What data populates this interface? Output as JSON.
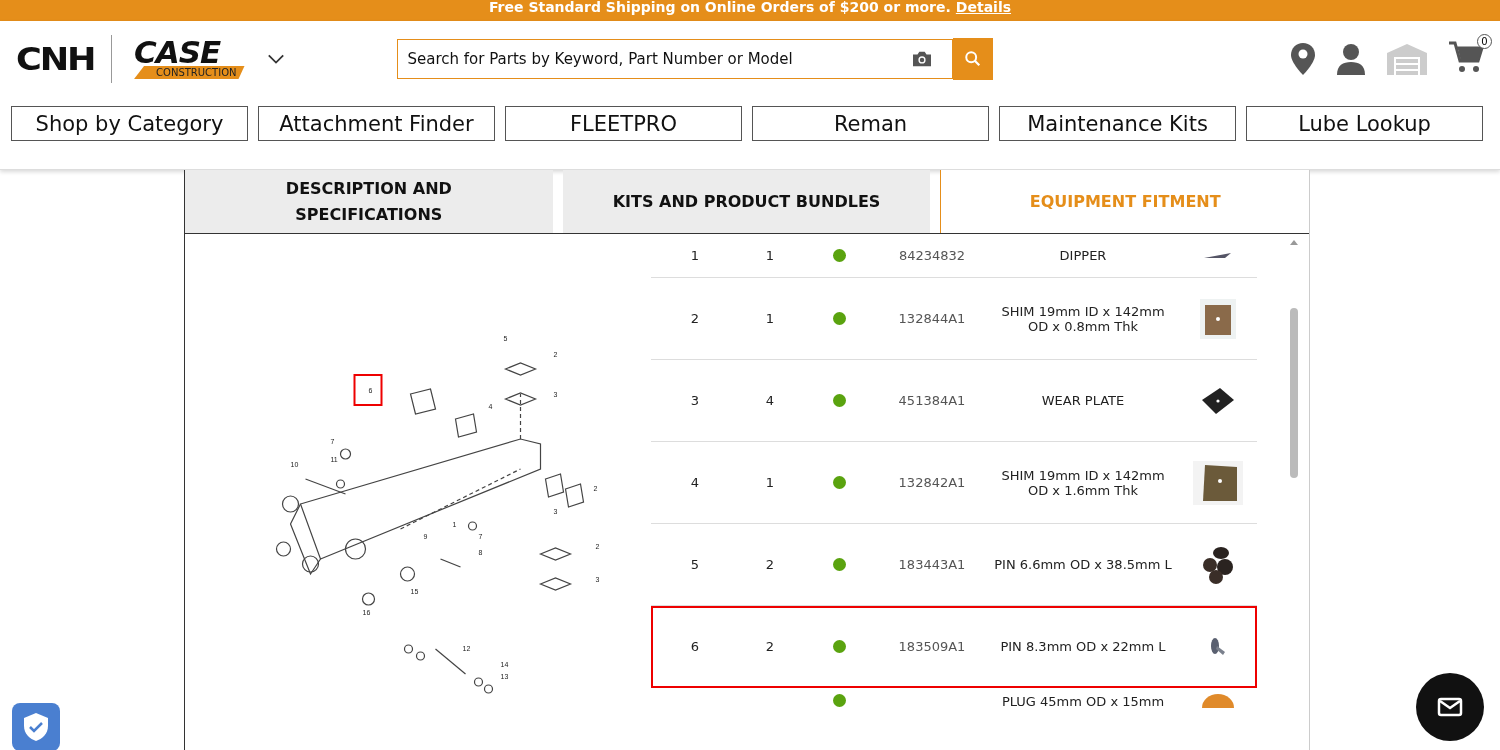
{
  "promo_banner": {
    "text": "Free Standard Shipping on Online Orders of $200 or more.",
    "link": "Details"
  },
  "header": {
    "logo": "CNH",
    "brand_small": "CASE",
    "brand_sub": "CONSTRUCTION",
    "search": {
      "placeholder": "Search for Parts by Keyword, Part Number or Model"
    },
    "cart_count": "0"
  },
  "nav": [
    "Shop by Category",
    "Attachment Finder",
    "FLEETPRO",
    "Reman",
    "Maintenance Kits",
    "Lube Lookup"
  ],
  "tabs": [
    {
      "label": "DESCRIPTION AND SPECIFICATIONS",
      "selected": false
    },
    {
      "label": "KITS AND PRODUCT BUNDLES",
      "selected": false
    },
    {
      "label": "EQUIPMENT FITMENT",
      "selected": true
    }
  ],
  "diagram": {
    "callouts": [
      {
        "label": "5",
        "highlighted": false
      },
      {
        "label": "2",
        "highlighted": false
      },
      {
        "label": "6",
        "highlighted": true
      },
      {
        "label": "4",
        "highlighted": false
      },
      {
        "label": "3",
        "highlighted": false
      },
      {
        "label": "7",
        "highlighted": false
      },
      {
        "label": "11",
        "highlighted": false
      },
      {
        "label": "10",
        "highlighted": false
      },
      {
        "label": "1",
        "highlighted": false
      },
      {
        "label": "9",
        "highlighted": false
      },
      {
        "label": "8",
        "highlighted": false
      },
      {
        "label": "7",
        "highlighted": false
      },
      {
        "label": "15",
        "highlighted": false
      },
      {
        "label": "16",
        "highlighted": false
      },
      {
        "label": "2",
        "highlighted": false
      },
      {
        "label": "3",
        "highlighted": false
      },
      {
        "label": "2",
        "highlighted": false
      },
      {
        "label": "3",
        "highlighted": false
      },
      {
        "label": "12",
        "highlighted": false
      },
      {
        "label": "14",
        "highlighted": false
      },
      {
        "label": "13",
        "highlighted": false
      }
    ]
  },
  "parts": [
    {
      "ref": "1",
      "qty": "1",
      "color": "#5aa30f",
      "part_number": "84234832",
      "description": "DIPPER",
      "selected": false
    },
    {
      "ref": "2",
      "qty": "1",
      "color": "#5aa30f",
      "part_number": "132844A1",
      "description": "SHIM 19mm ID x 142mm OD x 0.8mm Thk",
      "selected": false
    },
    {
      "ref": "3",
      "qty": "4",
      "color": "#5aa30f",
      "part_number": "451384A1",
      "description": "WEAR PLATE",
      "selected": false
    },
    {
      "ref": "4",
      "qty": "1",
      "color": "#5aa30f",
      "part_number": "132842A1",
      "description": "SHIM 19mm ID x 142mm OD x 1.6mm Thk",
      "selected": false
    },
    {
      "ref": "5",
      "qty": "2",
      "color": "#5aa30f",
      "part_number": "183443A1",
      "description": "PIN 6.6mm OD x 38.5mm L",
      "selected": false
    },
    {
      "ref": "6",
      "qty": "2",
      "color": "#5aa30f",
      "part_number": "183509A1",
      "description": "PIN 8.3mm OD x 22mm L",
      "selected": true
    },
    {
      "color": "#5aa30f",
      "description": "PLUG 45mm OD x 15mm",
      "selected": false
    }
  ]
}
